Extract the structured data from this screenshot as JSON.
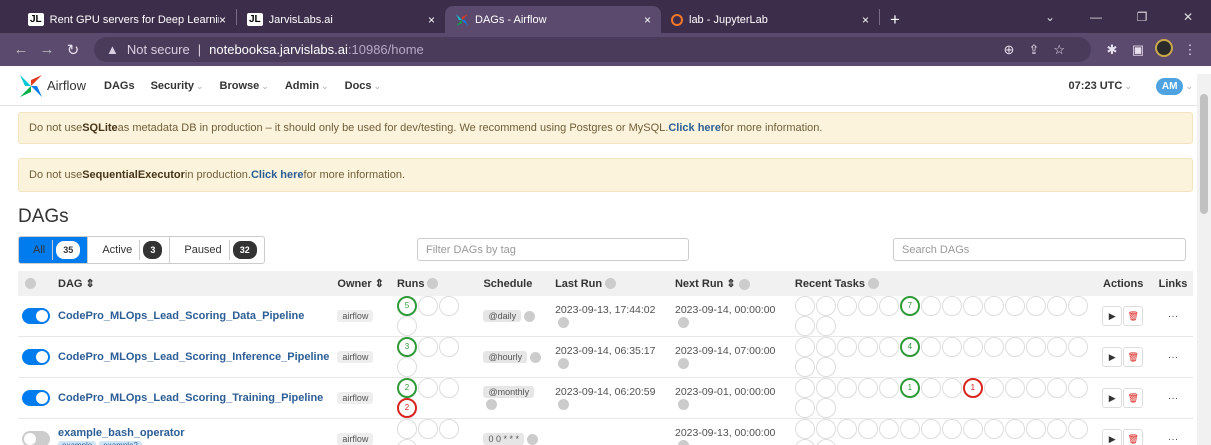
{
  "browser": {
    "tabs": [
      {
        "icon": "JL",
        "title": "Rent GPU servers for Deep Learning",
        "close": "×"
      },
      {
        "icon": "JL",
        "title": "JarvisLabs.ai",
        "close": "×"
      },
      {
        "icon": "airflow-icon",
        "title": "DAGs - Airflow",
        "close": "×"
      },
      {
        "icon": "jupyter-icon",
        "title": "lab - JupyterLab",
        "close": "×"
      }
    ],
    "new_tab": "+",
    "security_label": "Not secure",
    "url_domain": "notebooksa.jarvislabs.ai",
    "url_path": ":10986/home"
  },
  "app": {
    "logo_text": "Airflow",
    "nav": [
      "DAGs",
      "Security",
      "Browse",
      "Admin",
      "Docs"
    ],
    "time": "07:23 UTC",
    "user": "AM"
  },
  "alerts": [
    {
      "pre": "Do not use ",
      "bold": "SQLite",
      "mid": " as metadata DB in production – it should only be used for dev/testing. We recommend using Postgres or MySQL. ",
      "link": "Click here",
      "post": " for more information."
    },
    {
      "pre": "Do not use ",
      "bold": "SequentialExecutor",
      "mid": " in production. ",
      "link": "Click here",
      "post": " for more information."
    }
  ],
  "page_title": "DAGs",
  "filters": {
    "all_label": "All",
    "all_count": "35",
    "active_label": "Active",
    "active_count": "3",
    "paused_label": "Paused",
    "paused_count": "32",
    "tag_placeholder": "Filter DAGs by tag",
    "search_placeholder": "Search DAGs"
  },
  "table": {
    "headers": {
      "dag": "DAG",
      "owner": "Owner",
      "runs": "Runs",
      "schedule": "Schedule",
      "last_run": "Last Run",
      "next_run": "Next Run",
      "recent": "Recent Tasks",
      "actions": "Actions",
      "links": "Links"
    },
    "rows": [
      {
        "name": "CodePro_MLOps_Lead_Scoring_Data_Pipeline",
        "active": true,
        "owner": "airflow",
        "runs": [
          "5",
          "",
          "",
          ""
        ],
        "schedule": "@daily",
        "last_run": "2023-09-13, 17:44:02",
        "next_run": "2023-09-14, 00:00:00",
        "recent": [
          "",
          "",
          "",
          "",
          "",
          "7",
          "",
          "",
          "",
          "",
          "",
          "",
          "",
          "",
          "",
          ""
        ],
        "links": "···"
      },
      {
        "name": "CodePro_MLOps_Lead_Scoring_Inference_Pipeline",
        "active": true,
        "owner": "airflow",
        "runs": [
          "3",
          "",
          "",
          ""
        ],
        "schedule": "@hourly",
        "last_run": "2023-09-14, 06:35:17",
        "next_run": "2023-09-14, 07:00:00",
        "recent": [
          "",
          "",
          "",
          "",
          "",
          "4",
          "",
          "",
          "",
          "",
          "",
          "",
          "",
          "",
          "",
          ""
        ],
        "links": "···"
      },
      {
        "name": "CodePro_MLOps_Lead_Scoring_Training_Pipeline",
        "active": true,
        "owner": "airflow",
        "runs": [
          "2",
          "",
          "",
          "2"
        ],
        "schedule": "@monthly",
        "last_run": "2023-09-14, 06:20:59",
        "next_run": "2023-09-01, 00:00:00",
        "recent": [
          "",
          "",
          "",
          "",
          "",
          "1",
          "",
          "",
          "1",
          "",
          "",
          "",
          "",
          "",
          "",
          ""
        ],
        "links": "···"
      },
      {
        "name": "example_bash_operator",
        "active": false,
        "owner": "airflow",
        "runs": [
          "",
          "",
          "",
          ""
        ],
        "schedule": "0 0 * * *",
        "last_run": "",
        "next_run": "2023-09-13, 00:00:00",
        "recent": [
          "",
          "",
          "",
          "",
          "",
          "",
          "",
          "",
          "",
          "",
          "",
          "",
          "",
          "",
          "",
          ""
        ],
        "tags": [
          "example",
          "example2"
        ],
        "links": "···"
      }
    ]
  },
  "colors": {
    "success": "#2f9a38",
    "failed": "#d9241e",
    "accent": "#017cee"
  }
}
